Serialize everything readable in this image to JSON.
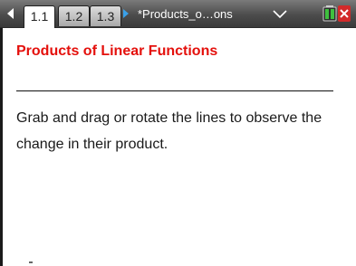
{
  "topbar": {
    "tabs": [
      {
        "label": "1.1",
        "active": true
      },
      {
        "label": "1.2",
        "active": false
      },
      {
        "label": "1.3",
        "active": false
      }
    ],
    "document_title": "*Products_o…ons",
    "icons": {
      "prev_page": "triangle-left-icon",
      "next_page": "triangle-right-icon",
      "doc_menu": "chevron-down-icon",
      "battery": "battery-icon",
      "close": "close-icon"
    },
    "colors": {
      "bar": "#4c4c4c",
      "next_arrow": "#3aa0e8",
      "close": "#d22a2a"
    }
  },
  "main": {
    "title": "Products of Linear Functions",
    "title_color": "#e4100c",
    "instructions": "Grab and drag or rotate the lines to observe the change in their product."
  }
}
